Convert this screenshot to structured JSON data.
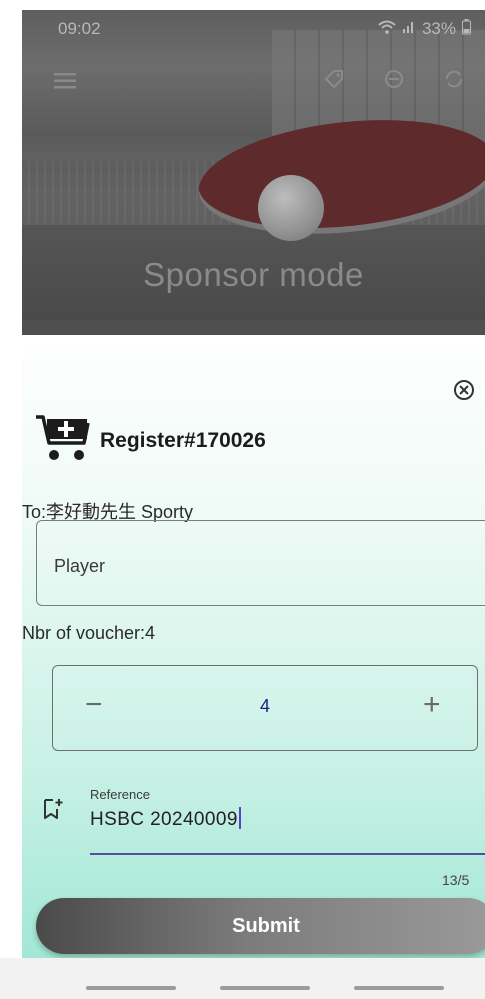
{
  "status_bar": {
    "time": "09:02",
    "battery": "33%"
  },
  "hero": {
    "title": "Sponsor mode"
  },
  "sheet": {
    "register_title": "Register#170026",
    "to_line": "To:李好動先生 Sporty",
    "player_value": "Player",
    "nbr_line": "Nbr of voucher:4",
    "stepper": {
      "minus": "−",
      "value": "4",
      "plus": "+"
    },
    "reference": {
      "label": "Reference",
      "value": "HSBC 20240009",
      "counter": "13/5"
    },
    "submit_label": "Submit"
  },
  "colors": {
    "accent_underline": "#5a4aa8",
    "sheet_gradient_end": "#a2e7d5",
    "stepper_value": "#1a237e"
  },
  "icons": {
    "menu": "menu-icon",
    "close": "close-circle-icon",
    "cart": "cart-plus-icon",
    "reference": "tag-add-icon"
  }
}
